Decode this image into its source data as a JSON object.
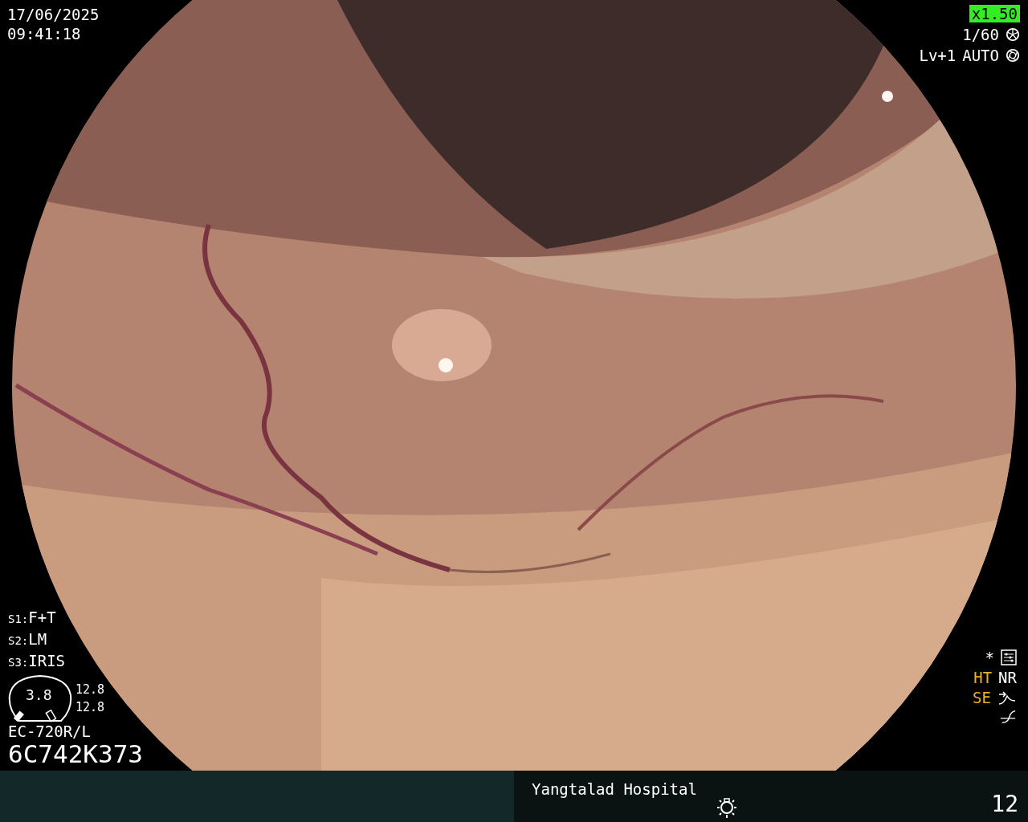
{
  "datetime": {
    "date": "17/06/2025",
    "time": "09:41:18"
  },
  "top_right": {
    "zoom": "x1.50",
    "shutter": "1/60",
    "level": "Lv+1",
    "mode": "AUTO"
  },
  "scope_settings": [
    {
      "label": "S1:",
      "value": "F+T"
    },
    {
      "label": "S2:",
      "value": "LM"
    },
    {
      "label": "S3:",
      "value": "IRIS"
    }
  ],
  "gauge": {
    "value": "3.8",
    "readings": [
      "12.8",
      "12.8"
    ]
  },
  "scope_model": "EC-720R/L",
  "serial": "6C742K373",
  "indicators": {
    "mark": "*",
    "modes": [
      {
        "label": "HT",
        "active": true
      },
      {
        "label": "NR",
        "active": false
      },
      {
        "label": "SE",
        "active": true
      }
    ]
  },
  "footer": {
    "hospital": "Yangtalad Hospital",
    "count": "12"
  }
}
